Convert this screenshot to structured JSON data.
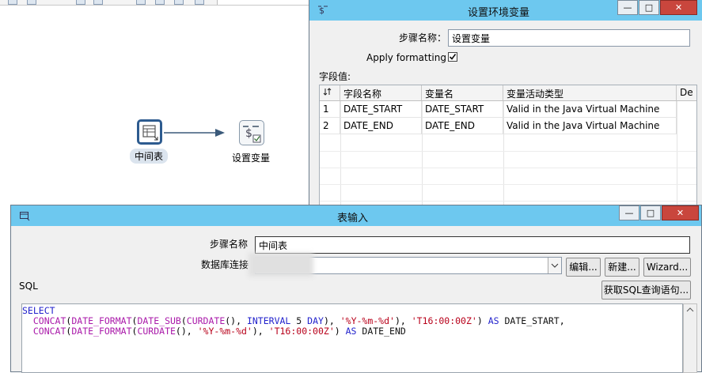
{
  "canvas": {
    "nodes": [
      {
        "label": "中间表"
      },
      {
        "label": "设置变量"
      }
    ]
  },
  "set_var_dialog": {
    "title": "设置环境变量",
    "step_name_label": "步骤名称：",
    "step_name_value": "设置变量",
    "apply_formatting_label": "Apply formatting",
    "apply_formatting_checked": true,
    "field_values_label": "字段值:",
    "table": {
      "headers": [
        "#",
        "字段名称",
        "变量名",
        "变量活动类型",
        "De"
      ],
      "rows": [
        [
          "1",
          "DATE_START",
          "DATE_START",
          "Valid in the Java Virtual Machine"
        ],
        [
          "2",
          "DATE_END",
          "DATE_END",
          "Valid in the Java Virtual Machine"
        ]
      ]
    }
  },
  "table_input_dialog": {
    "title": "表输入",
    "step_name_label": "步骤名称",
    "step_name_value": "中间表",
    "db_connection_label": "数据库连接",
    "edit_button": "编辑...",
    "new_button": "新建...",
    "wizard_button": "Wizard...",
    "sql_label": "SQL",
    "get_sql_button": "获取SQL查询语句...",
    "sql_lines": [
      "SELECT",
      "  CONCAT(DATE_FORMAT(DATE_SUB(CURDATE(), INTERVAL 5 DAY), '%Y-%m-%d'), 'T16:00:00Z') AS DATE_START,",
      "  CONCAT(DATE_FORMAT(CURDATE(), '%Y-%m-%d'), 'T16:00:00Z') AS DATE_END"
    ]
  },
  "window_buttons": {
    "minimize": "—",
    "maximize": "□",
    "close": "✕"
  },
  "colors": {
    "titlebar": "#6dc8ef",
    "close": "#c9463d",
    "keyword": "#2222cc",
    "function": "#aa1aaa",
    "string": "#b8001a"
  }
}
